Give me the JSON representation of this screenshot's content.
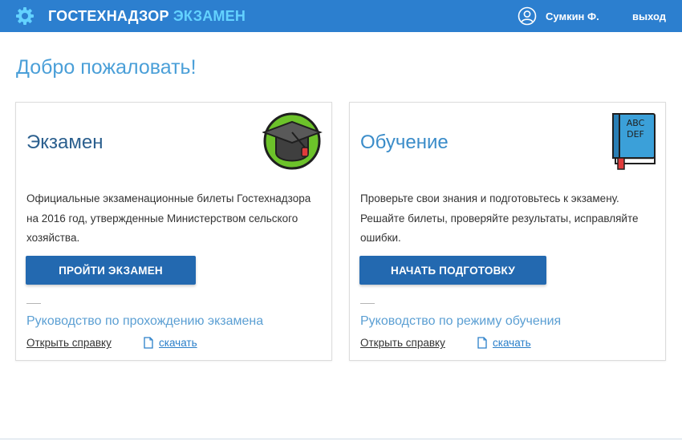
{
  "header": {
    "brand_main": "ГОСТЕХНАДЗОР",
    "brand_accent": "ЭКЗАМЕН",
    "user_name": "Сумкин Ф.",
    "logout_label": "выход",
    "bar_color": "#2c7fcf"
  },
  "welcome": "Добро пожаловать!",
  "cards": {
    "exam": {
      "title": "Экзамен",
      "icon": "graduation-cap-icon",
      "description": "Официальные экзаменационные билеты Гостехнадзора на 2016 год, утвержденные Министерством сельского хозяйства.",
      "button_label": "ПРОЙТИ ЭКЗАМЕН",
      "guide_label": "Руководство по прохождению экзамена",
      "help_label": "Открыть справку",
      "download_label": "скачать"
    },
    "study": {
      "title": "Обучение",
      "icon": "abc-book-icon",
      "description": "Проверьте свои знания и подготовьтесь к экзамену. Решайте билеты, проверяйте результаты, исправляйте ошибки.",
      "button_label": "НАЧАТЬ ПОДГОТОВКУ",
      "guide_label": "Руководство по режиму обучения",
      "help_label": "Открыть справку",
      "download_label": "скачать",
      "book_text_line1": "ABC",
      "book_text_line2": "DEF"
    }
  },
  "colors": {
    "button": "#2369b0",
    "accent": "#63d2ff",
    "link": "#2a7fc9"
  }
}
